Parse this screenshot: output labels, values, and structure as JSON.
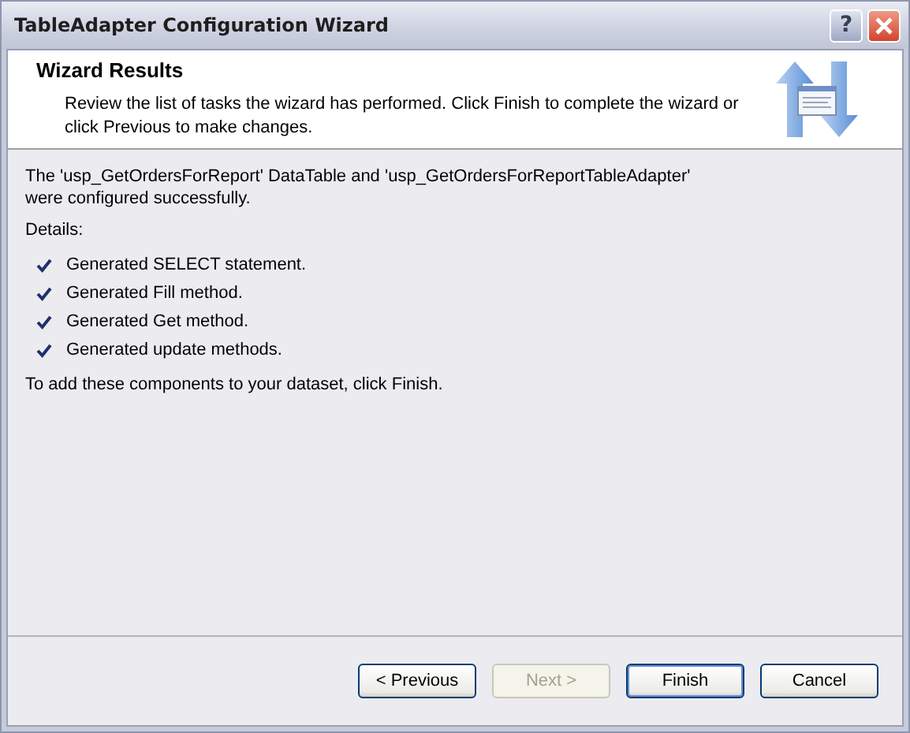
{
  "window": {
    "title": "TableAdapter Configuration Wizard",
    "buttons": [
      {
        "kind": "help",
        "label": "?"
      },
      {
        "kind": "close"
      }
    ]
  },
  "header": {
    "title": "Wizard Results",
    "description": "Review the list of tasks the wizard has performed. Click Finish to complete the wizard or click Previous to make changes."
  },
  "summary": "The 'usp_GetOrdersForReport' DataTable and 'usp_GetOrdersForReportTableAdapter' were configured successfully.",
  "details_label": "Details:",
  "tasks": [
    {
      "label": "Generated SELECT statement.",
      "done": true
    },
    {
      "label": "Generated Fill method.",
      "done": true
    },
    {
      "label": "Generated Get method.",
      "done": true
    },
    {
      "label": "Generated update methods.",
      "done": true
    }
  ],
  "footer_note": "To add these components to your dataset, click Finish.",
  "buttons": [
    {
      "label": "< Previous",
      "disabled": false,
      "default": false
    },
    {
      "label": "Next >",
      "disabled": true,
      "default": false
    },
    {
      "label": "Finish",
      "disabled": false,
      "default": true
    },
    {
      "label": "Cancel",
      "disabled": false,
      "default": false
    }
  ]
}
